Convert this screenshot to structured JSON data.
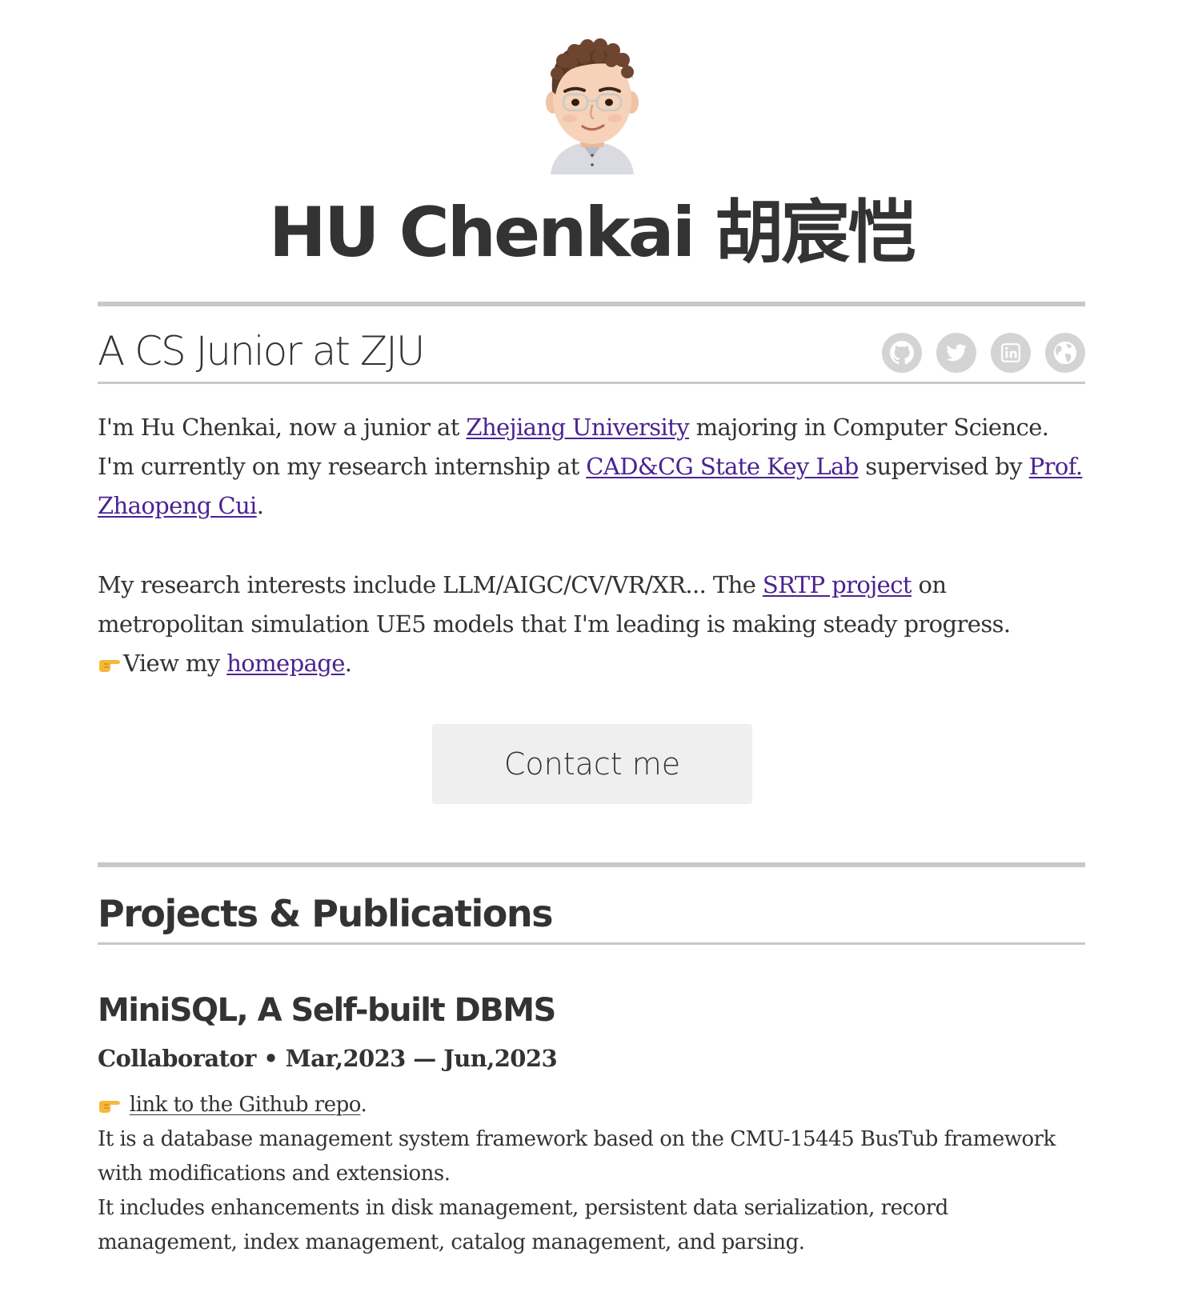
{
  "profile": {
    "name": "HU Chenkai 胡宸恺",
    "tagline": "A CS Junior at ZJU"
  },
  "socials": [
    {
      "icon": "github-icon",
      "label": "GitHub"
    },
    {
      "icon": "twitter-icon",
      "label": "Twitter"
    },
    {
      "icon": "linkedin-icon",
      "label": "LinkedIn"
    },
    {
      "icon": "globe-icon",
      "label": "Website"
    }
  ],
  "intro": {
    "p1_a": "I'm Hu Chenkai, now a junior at ",
    "p1_link1": "Zhejiang University",
    "p1_b": " majoring in Computer Science. I'm currently on my research internship at ",
    "p1_link2": "CAD&CG State Key Lab",
    "p1_c": " supervised by ",
    "p1_link3": "Prof. Zhaopeng Cui",
    "p1_d": ".",
    "p2_a": "My research interests include LLM/AIGC/CV/VR/XR... The ",
    "p2_link1": "SRTP project",
    "p2_b": " on metropolitan simulation UE5 models that I'm leading is making steady progress.",
    "p3_a": "View my ",
    "p3_link": "homepage",
    "p3_b": "."
  },
  "contact_button": "Contact me",
  "section": {
    "title": "Projects & Publications"
  },
  "project": {
    "title": "MiniSQL, A Self-built DBMS",
    "meta": "Collaborator • Mar,2023 — Jun,2023",
    "link": "link to the Github repo",
    "link_suffix": ".",
    "line1": "It is a database management system framework based on the CMU-15445 BusTub framework with modifications and extensions.",
    "line2": "It includes enhancements in disk management, persistent data serialization, record management, index management, catalog management, and parsing."
  },
  "colors": {
    "text": "#333333",
    "link": "#4b2390",
    "rule": "#c8c8c8",
    "icon_bg": "#d4d4d4",
    "button_bg": "#efefef"
  }
}
